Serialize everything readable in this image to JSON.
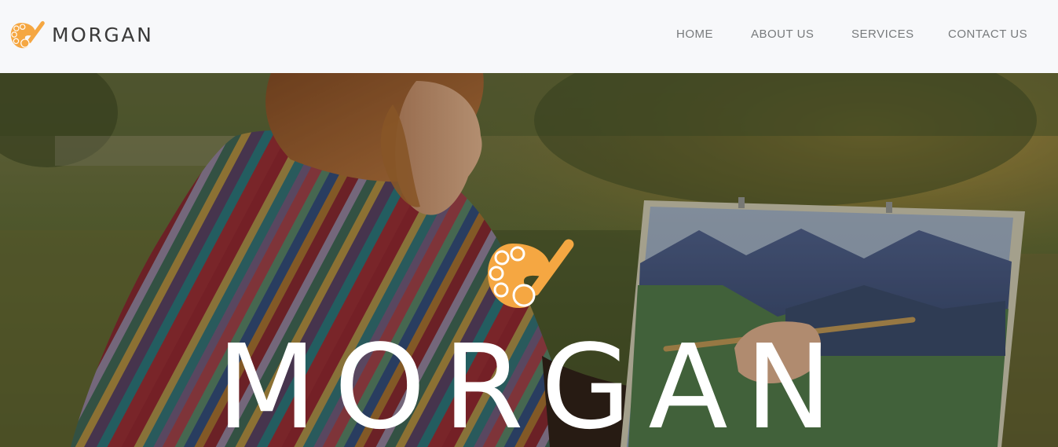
{
  "brand": {
    "name": "MORGAN",
    "logo_icon": "palette-brush-icon",
    "accent_color": "#f5a742"
  },
  "nav": {
    "items": [
      {
        "label": "HOME"
      },
      {
        "label": "ABOUT US"
      },
      {
        "label": "SERVICES"
      },
      {
        "label": "CONTACT US"
      }
    ]
  },
  "hero": {
    "title": "MORGAN",
    "logo_icon": "palette-brush-icon",
    "background_image": "woman-painting-landscape-outdoors"
  }
}
